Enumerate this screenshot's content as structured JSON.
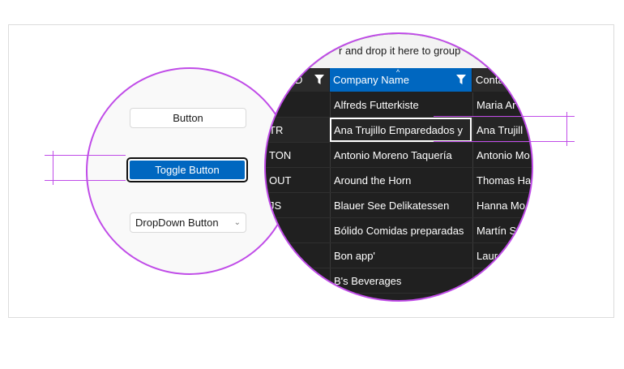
{
  "controls": {
    "button_label": "Button",
    "toggle_label": "Toggle Button",
    "dropdown_label": "DropDown Button"
  },
  "grid": {
    "group_panel_text": "r and drop it here to group",
    "columns": [
      {
        "label": "D"
      },
      {
        "label": "Company Name"
      },
      {
        "label": "Conta"
      }
    ],
    "rows": [
      {
        "id": "",
        "company": "Alfreds Futterkiste",
        "contact": "Maria Ar"
      },
      {
        "id": "TR",
        "company": "Ana Trujillo Emparedados y",
        "contact": "Ana Trujill"
      },
      {
        "id": "TON",
        "company": "Antonio Moreno Taquería",
        "contact": "Antonio Mo"
      },
      {
        "id": "OUT",
        "company": "Around the Horn",
        "contact": "Thomas Ha"
      },
      {
        "id": "JS",
        "company": "Blauer See Delikatessen",
        "contact": "Hanna Mo"
      },
      {
        "id": "",
        "company": "Bólido Comidas preparadas",
        "contact": "Martín S"
      },
      {
        "id": "",
        "company": "Bon app'",
        "contact": "Laure"
      },
      {
        "id": "",
        "company": "B's Beverages",
        "contact": ""
      }
    ]
  },
  "colors": {
    "accent": "#0067c0",
    "highlight_ring": "#c04ce8",
    "grid_background": "#202020"
  }
}
